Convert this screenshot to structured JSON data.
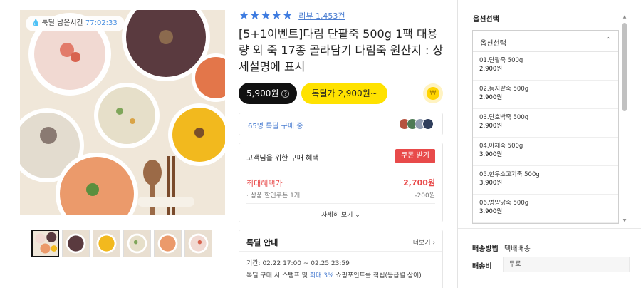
{
  "image": {
    "timer_label": "툭딜 남은시간",
    "timer_value": "77:02:33"
  },
  "rating": {
    "stars": "★★★★★",
    "review_link": "리뷰 1,453건"
  },
  "product": {
    "title": "[5+1이벤트]다림 단팥죽 500g 1팩 대용량 외 죽 17종 골라담기 다림죽 원산지 : 상세설명에 표시"
  },
  "price": {
    "black_price": "5,900원",
    "deal_price": "톡딜가 2,900원~",
    "coin_symbol": "₩"
  },
  "buyers": {
    "text": "65명 톡딜 구매 중"
  },
  "benefit": {
    "title": "고객님을 위한 구매 혜택",
    "coupon_button": "쿠폰 받기",
    "max_label": "최대혜택가",
    "max_value": "2,700원",
    "sub_label": "· 상품 할인쿠폰 1개",
    "sub_value": "-200원",
    "detail_link": "자세히 보기 ⌄"
  },
  "deal": {
    "title": "톡딜 안내",
    "more_link": "더보기 ›",
    "period": "기간: 02.22 17:00 ~ 02.25 23:59",
    "note_prefix": "톡딜 구매 시 스탬프 및 ",
    "note_highlight": "최대 3%",
    "note_suffix": " 쇼핑포인트를 적립(등급별 상이)"
  },
  "options": {
    "heading": "옵션선택",
    "select_label": "옵션선택",
    "items": [
      {
        "name": "01.단팥죽 500g",
        "price": "2,900원"
      },
      {
        "name": "02.동지팥죽 500g",
        "price": "2,900원"
      },
      {
        "name": "03.단호박죽 500g",
        "price": "2,900원"
      },
      {
        "name": "04.야채죽 500g",
        "price": "3,900원"
      },
      {
        "name": "05.한우소고기죽 500g",
        "price": "3,900원"
      },
      {
        "name": "06.영양닭죽 500g",
        "price": "3,900원"
      }
    ]
  },
  "shipping": {
    "method_label": "배송방법",
    "method_value": "택배배송",
    "fee_label": "배송비",
    "fee_value": "무료"
  },
  "colors": {
    "accent_blue": "#3d7be0",
    "coupon_red": "#e84a4a",
    "deal_yellow": "#ffe200"
  }
}
